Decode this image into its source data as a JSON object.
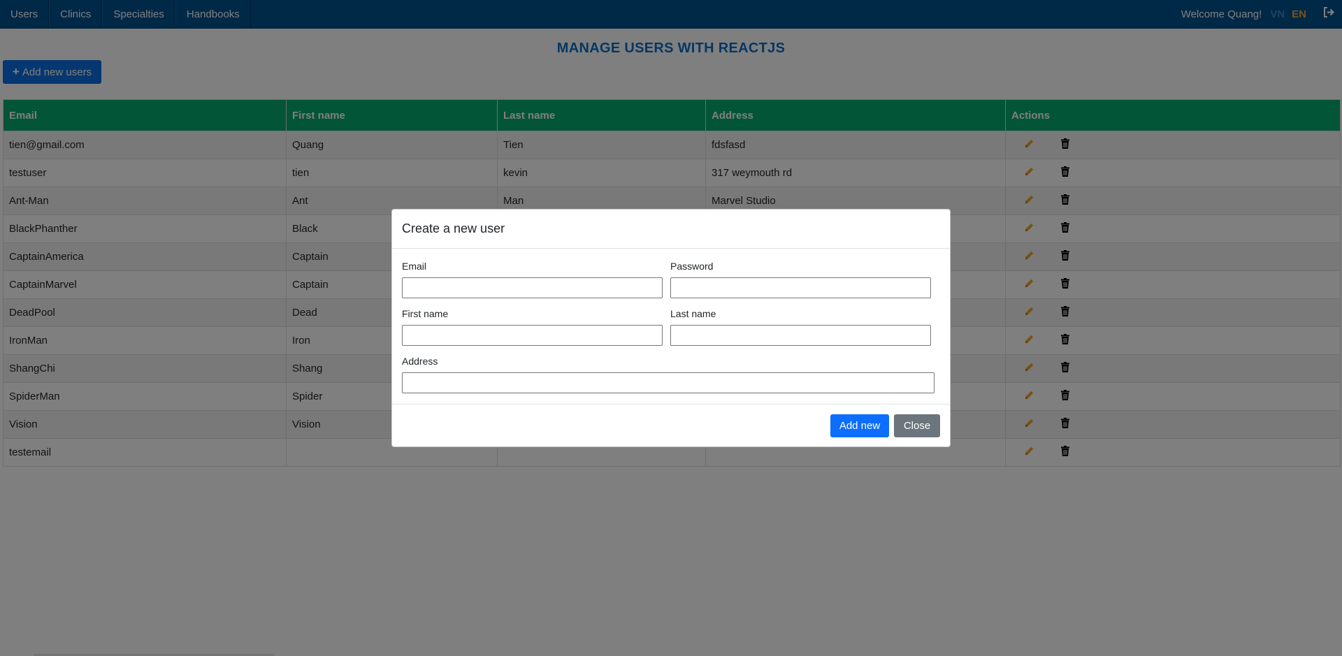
{
  "nav": {
    "items": [
      {
        "label": "Users"
      },
      {
        "label": "Clinics"
      },
      {
        "label": "Specialties"
      },
      {
        "label": "Handbooks"
      }
    ],
    "welcome": "Welcome Quang!",
    "lang_vn": "VN",
    "lang_en": "EN",
    "logout_icon": "sign-out-icon"
  },
  "page": {
    "title": "MANAGE USERS WITH REACTJS",
    "add_button_label": "Add new users",
    "add_button_icon": "plus-icon"
  },
  "table": {
    "headers": [
      "Email",
      "First name",
      "Last name",
      "Address",
      "Actions"
    ],
    "rows": [
      {
        "email": "tien@gmail.com",
        "first": "Quang",
        "last": "Tien",
        "address": "fdsfasd"
      },
      {
        "email": "testuser",
        "first": "tien",
        "last": "kevin",
        "address": "317 weymouth rd"
      },
      {
        "email": "Ant-Man",
        "first": "Ant",
        "last": "Man",
        "address": "Marvel Studio"
      },
      {
        "email": "BlackPhanther",
        "first": "Black",
        "last": "",
        "address": ""
      },
      {
        "email": "CaptainAmerica",
        "first": "Captain",
        "last": "",
        "address": ""
      },
      {
        "email": "CaptainMarvel",
        "first": "Captain",
        "last": "",
        "address": ""
      },
      {
        "email": "DeadPool",
        "first": "Dead",
        "last": "",
        "address": ""
      },
      {
        "email": "IronMan",
        "first": "Iron",
        "last": "",
        "address": ""
      },
      {
        "email": "ShangChi",
        "first": "Shang",
        "last": "",
        "address": ""
      },
      {
        "email": "SpiderMan",
        "first": "Spider",
        "last": "",
        "address": ""
      },
      {
        "email": "Vision",
        "first": "Vision",
        "last": "",
        "address": ""
      },
      {
        "email": "testemail",
        "first": "",
        "last": "",
        "address": ""
      }
    ],
    "edit_icon": "pencil-icon",
    "delete_icon": "trash-icon"
  },
  "modal": {
    "title": "Create a new user",
    "email_label": "Email",
    "email_value": "",
    "password_label": "Password",
    "password_value": "",
    "first_name_label": "First name",
    "first_name_value": "",
    "last_name_label": "Last name",
    "last_name_value": "",
    "address_label": "Address",
    "address_value": "",
    "add_button": "Add new",
    "close_button": "Close"
  },
  "colors": {
    "navbar": "#00508f",
    "table_header": "#04aa6d",
    "title": "#0a6ec7",
    "primary": "#0d6efd",
    "secondary": "#6c757d",
    "edit": "#f0a02a",
    "lang_active": "#f4a62a"
  }
}
